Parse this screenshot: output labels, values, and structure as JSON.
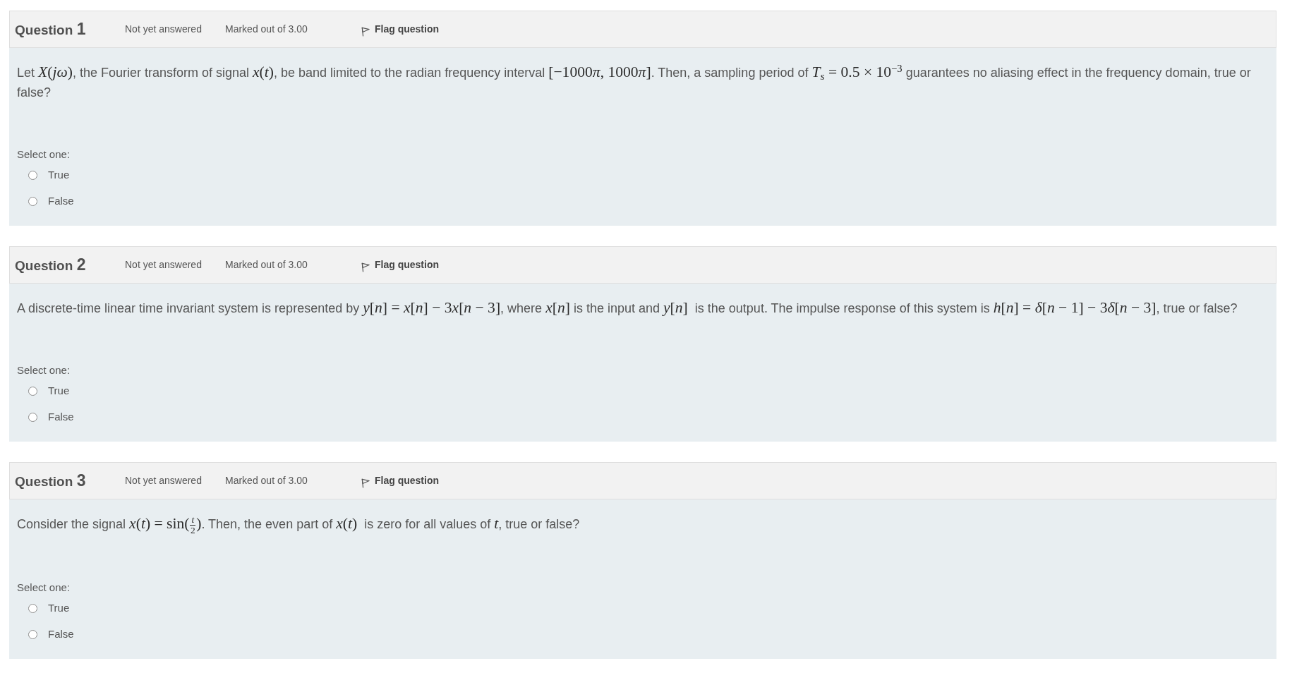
{
  "questions": [
    {
      "label": "Question",
      "number": "1",
      "status": "Not yet answered",
      "grade": "Marked out of 3.00",
      "flag": {
        "label": "Flag question",
        "flagged": false
      },
      "text": [
        {
          "kind": "text",
          "text": "Let "
        },
        {
          "kind": "math",
          "text": "*X*(*jω*)"
        },
        {
          "kind": "text",
          "text": ", the Fourier transform of signal "
        },
        {
          "kind": "math",
          "text": "*x*(*t*)"
        },
        {
          "kind": "text",
          "text": ", be band limited to the radian frequency interval "
        },
        {
          "kind": "math",
          "text": "[−1000"
        },
        {
          "kind": "math",
          "text": "*π*, 1000"
        },
        {
          "kind": "math",
          "text": "*π*]"
        },
        {
          "kind": "text",
          "text": ". Then, a sampling period of "
        },
        {
          "kind": "math",
          "text": "*T*$_{s}$ = 0.5 × 10$^{−3}$"
        },
        {
          "kind": "text",
          "text": " guarantees no aliasing effect in the frequency domain, true or false?"
        }
      ],
      "prompt": "Select one:",
      "options": [
        {
          "label": "True",
          "selected": false
        },
        {
          "label": "False",
          "selected": false
        }
      ]
    },
    {
      "label": "Question",
      "number": "2",
      "status": "Not yet answered",
      "grade": "Marked out of 3.00",
      "flag": {
        "label": "Flag question",
        "flagged": false
      },
      "text": [
        {
          "kind": "text",
          "text": "A discrete-time linear time invariant system is represented by "
        },
        {
          "kind": "math",
          "text": "*y*[*n*] = *x*[*n*] − 3"
        },
        {
          "kind": "math",
          "text": "*x*[*n* − 3]"
        },
        {
          "kind": "text",
          "text": ", where "
        },
        {
          "kind": "math",
          "text": "*x*[*n*]"
        },
        {
          "kind": "text",
          "text": " is the input and "
        },
        {
          "kind": "math",
          "text": "*y*[*n*]"
        },
        {
          "kind": "text",
          "text": "  is the output. The impulse response of this system is "
        },
        {
          "kind": "math",
          "text": "*h*[*n*] = *δ*[*n* − 1] − 3"
        },
        {
          "kind": "math",
          "text": "*δ*[*n* − 3]"
        },
        {
          "kind": "text",
          "text": ", true or false?"
        }
      ],
      "prompt": "Select one:",
      "options": [
        {
          "label": "True",
          "selected": false
        },
        {
          "label": "False",
          "selected": false
        }
      ]
    },
    {
      "label": "Question",
      "number": "3",
      "status": "Not yet answered",
      "grade": "Marked out of 3.00",
      "flag": {
        "label": "Flag question",
        "flagged": false
      },
      "text": [
        {
          "kind": "text",
          "text": "Consider the signal "
        },
        {
          "kind": "math",
          "text": "*x*(*t*) = sin("
        },
        {
          "kind": "fraction",
          "numerator": "t",
          "denominator": "2"
        },
        {
          "kind": "math",
          "text": ")"
        },
        {
          "kind": "text",
          "text": ". Then, the even part of "
        },
        {
          "kind": "math",
          "text": "*x*(*t*)"
        },
        {
          "kind": "text",
          "text": "  is zero for all values of "
        },
        {
          "kind": "math",
          "text": "*t*"
        },
        {
          "kind": "text",
          "text": ", true or false?"
        }
      ],
      "prompt": "Select one:",
      "options": [
        {
          "label": "True",
          "selected": false
        },
        {
          "label": "False",
          "selected": false
        }
      ]
    }
  ]
}
